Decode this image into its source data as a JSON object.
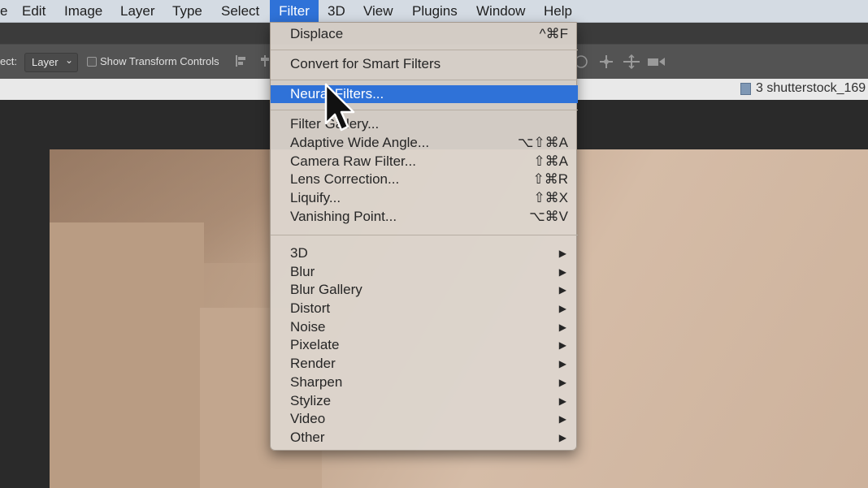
{
  "menubar": {
    "items": [
      {
        "label": "e"
      },
      {
        "label": "Edit"
      },
      {
        "label": "Image"
      },
      {
        "label": "Layer"
      },
      {
        "label": "Type"
      },
      {
        "label": "Select"
      },
      {
        "label": "Filter"
      },
      {
        "label": "3D"
      },
      {
        "label": "View"
      },
      {
        "label": "Plugins"
      },
      {
        "label": "Window"
      },
      {
        "label": "Help"
      }
    ]
  },
  "options": {
    "select_label": "ect:",
    "select_value": "Layer",
    "show_transform_label": "Show Transform Controls"
  },
  "document_tab": {
    "title": "3 shutterstock_169"
  },
  "filter_menu": {
    "top": [
      {
        "label": "Displace",
        "shortcut": "^⌘F"
      },
      {
        "label": "Convert for Smart Filters"
      },
      {
        "label": "Neural Filters..."
      },
      {
        "label": "Filter Gallery..."
      }
    ],
    "middle": [
      {
        "label": "Adaptive Wide Angle...",
        "shortcut": "⌥⇧⌘A"
      },
      {
        "label": "Camera Raw Filter...",
        "shortcut": "⇧⌘A"
      },
      {
        "label": "Lens Correction...",
        "shortcut": "⇧⌘R"
      },
      {
        "label": "Liquify...",
        "shortcut": "⇧⌘X"
      },
      {
        "label": "Vanishing Point...",
        "shortcut": "⌥⌘V"
      }
    ],
    "submenus": [
      {
        "label": "3D",
        "arrow": "▶"
      },
      {
        "label": "Blur",
        "arrow": "▶"
      },
      {
        "label": "Blur Gallery",
        "arrow": "▶"
      },
      {
        "label": "Distort",
        "arrow": "▶"
      },
      {
        "label": "Noise",
        "arrow": "▶"
      },
      {
        "label": "Pixelate",
        "arrow": "▶"
      },
      {
        "label": "Render",
        "arrow": "▶"
      },
      {
        "label": "Sharpen",
        "arrow": "▶"
      },
      {
        "label": "Stylize",
        "arrow": "▶"
      },
      {
        "label": "Video",
        "arrow": "▶"
      },
      {
        "label": "Other",
        "arrow": "▶"
      }
    ]
  },
  "colors": {
    "highlight": "#2f72d8",
    "menubar_bg": "#d4dbe3"
  }
}
